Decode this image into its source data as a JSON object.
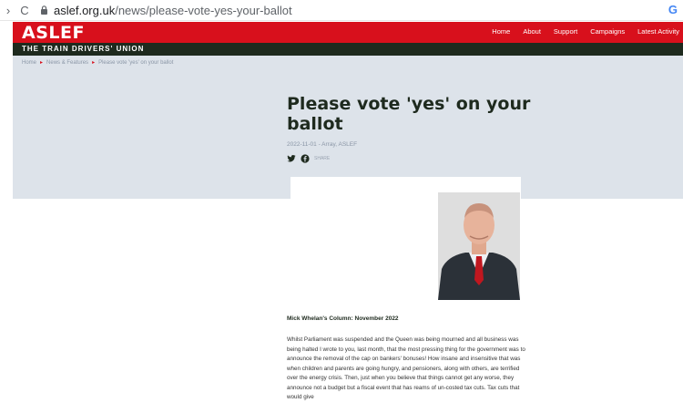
{
  "browser": {
    "back": "›",
    "reload": "C",
    "url_domain": "aslef.org.uk",
    "url_path": "/news/please-vote-yes-your-ballot",
    "account_icon": "G"
  },
  "site": {
    "logo": "ASLEF",
    "tagline": "THE TRAIN DRIVERS' UNION",
    "nav": [
      "Home",
      "About",
      "Support",
      "Campaigns",
      "Latest Activity"
    ],
    "brand_color": "#d8101c"
  },
  "breadcrumb": {
    "items": [
      "Home",
      "News & Features",
      "Please vote 'yes' on your ballot"
    ]
  },
  "article": {
    "title": "Please vote 'yes' on your ballot",
    "meta": "2022-11-01 - Array, ASLEF",
    "share_label": "SHARE",
    "column_heading": "Mick Whelan's Column: November 2022",
    "body": "Whilst Parliament was suspended and the Queen was being mourned and all business was being halted I wrote to you, last month, that the most pressing thing for the government was to announce the removal of the cap on bankers' bonuses! How insane and insensitive that was when children and parents are going hungry, and pensioners, along with others, are terrified over the energy crisis. Then, just when you believe that things cannot get any worse, they announce not a budget but a fiscal event that has reams of un-costed tax cuts. Tax cuts that would give"
  }
}
